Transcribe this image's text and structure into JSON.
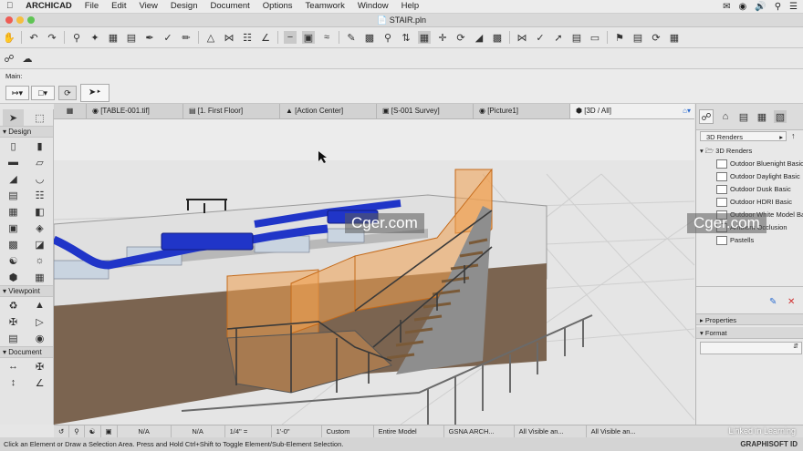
{
  "menubar": {
    "app": "ARCHICAD",
    "items": [
      "File",
      "Edit",
      "View",
      "Design",
      "Document",
      "Options",
      "Teamwork",
      "Window",
      "Help"
    ]
  },
  "window": {
    "title": "STAIR.pln"
  },
  "info_box": {
    "label": "Main:"
  },
  "toolbox": {
    "sections": {
      "design": "Design",
      "viewpoint": "Viewpoint",
      "document": "Document"
    }
  },
  "tabs": [
    {
      "label": "[TABLE-001.tif]"
    },
    {
      "label": "[1. First Floor]"
    },
    {
      "label": "[Action Center]"
    },
    {
      "label": "[S-001 Survey]"
    },
    {
      "label": "[Picture1]"
    },
    {
      "label": "[3D / All]"
    }
  ],
  "navigator": {
    "dropdown": "3D Renders",
    "folder": "3D Renders",
    "items": [
      "Outdoor Bluenight Basic",
      "Outdoor Daylight Basic",
      "Outdoor Dusk Basic",
      "Outdoor HDRI Basic",
      "Outdoor White Model Basic",
      "Ambient Occlusion",
      "Pastells"
    ],
    "properties_label": "Properties",
    "format_label": "Format"
  },
  "quickbar": {
    "zoom_na_1": "N/A",
    "zoom_na_2": "N/A",
    "scale": "1/4\"",
    "equals": "=",
    "dimension": "1'-0\"",
    "custom": "Custom",
    "model": "Entire Model",
    "standard": "GSNA ARCH...",
    "layers_1": "All Visible an...",
    "layers_2": "All Visible an..."
  },
  "status": {
    "text": "Click an Element or Draw a Selection Area. Press and Hold Ctrl+Shift to Toggle Element/Sub-Element Selection."
  },
  "watermarks": {
    "left": "Cger.com",
    "right": "Cger.com",
    "linkedin": "Linked in Learning",
    "graphisoft": "GRAPHISOFT ID"
  },
  "colors": {
    "accent": "#2f6fd1",
    "stair_orange": "#f0a050",
    "duct_blue": "#2035c8"
  }
}
